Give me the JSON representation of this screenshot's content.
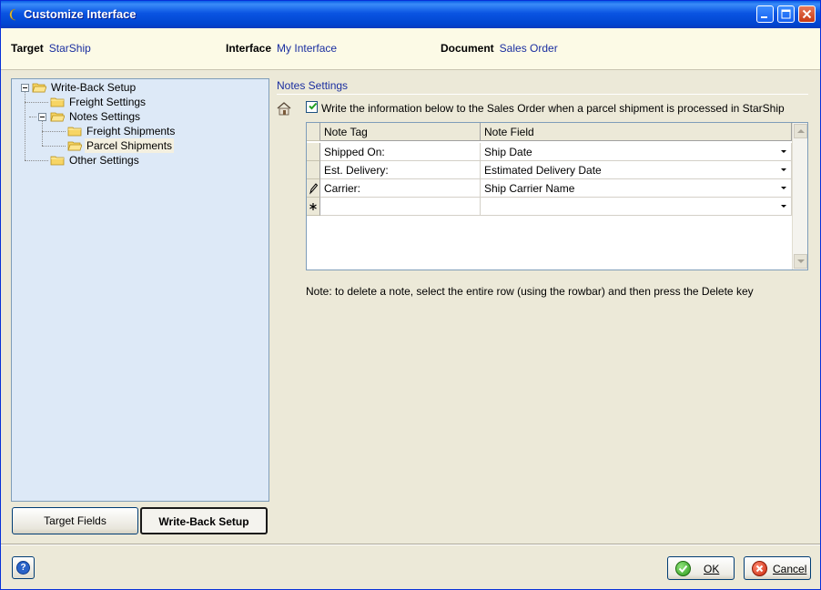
{
  "window": {
    "title": "Customize Interface"
  },
  "header": {
    "target_label": "Target",
    "target_value": "StarShip",
    "interface_label": "Interface",
    "interface_value": "My Interface",
    "document_label": "Document",
    "document_value": "Sales Order"
  },
  "tree": {
    "items": [
      {
        "label": "Write-Back Setup",
        "icon": "folder-open-icon"
      },
      {
        "label": "Freight Settings",
        "icon": "folder-icon"
      },
      {
        "label": "Notes Settings",
        "icon": "folder-open-icon"
      },
      {
        "label": "Freight Shipments",
        "icon": "folder-icon"
      },
      {
        "label": "Parcel Shipments",
        "icon": "folder-open-icon",
        "selected": true
      },
      {
        "label": "Other Settings",
        "icon": "folder-icon"
      }
    ]
  },
  "tabs": {
    "target_fields": "Target Fields",
    "write_back_setup": "Write-Back Setup"
  },
  "section": {
    "title": "Notes Settings",
    "checkbox_label": "Write the information below to the Sales Order when a parcel shipment is processed in StarShip",
    "checkbox_checked": true
  },
  "grid": {
    "columns": [
      "Note Tag",
      "Note Field"
    ],
    "rows": [
      {
        "tag": "Shipped On:",
        "field": "Ship Date"
      },
      {
        "tag": "Est. Delivery:",
        "field": "Estimated Delivery Date"
      },
      {
        "tag": "Carrier:",
        "field": "Ship Carrier Name"
      },
      {
        "tag": "",
        "field": ""
      }
    ]
  },
  "note": "Note: to delete a note, select the entire row (using the rowbar) and then press the Delete key",
  "buttons": {
    "ok": "OK",
    "cancel": "Cancel",
    "help": "?"
  },
  "colors": {
    "title_bar": "#0054e3",
    "header_bg": "#fcfae6",
    "tree_bg": "#dde9f7",
    "link_text": "#1a2ea0"
  }
}
